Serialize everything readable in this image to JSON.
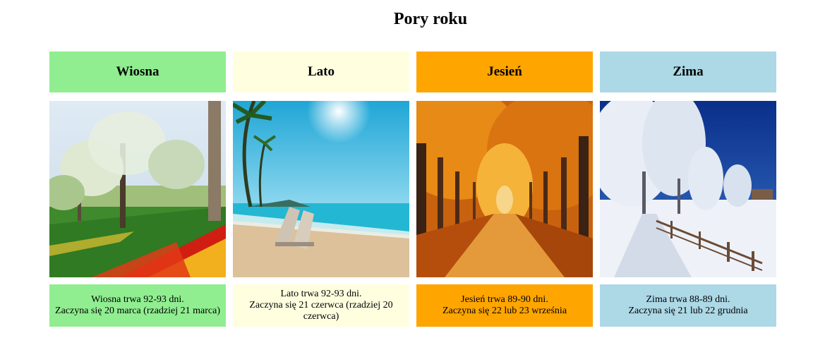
{
  "page": {
    "title": "Pory roku"
  },
  "seasons": [
    {
      "name": "Wiosna",
      "color": "#90EE90",
      "image": "spring-park-tulips",
      "line1": "Wiosna trwa 92-93 dni.",
      "line2": "Zaczyna się 20 marca (rzadziej 21 marca)"
    },
    {
      "name": "Lato",
      "color": "#FFFFE0",
      "image": "summer-beach-loungers",
      "line1": "Lato trwa 92-93 dni.",
      "line2": "Zaczyna się 21 czerwca (rzadziej 20 czerwca)"
    },
    {
      "name": "Jesień",
      "color": "#FFA500",
      "image": "autumn-tree-alley",
      "line1": "Jesień trwa 89-90 dni.",
      "line2": "Zaczyna się 22 lub 23 września"
    },
    {
      "name": "Zima",
      "color": "#ADD8E6",
      "image": "winter-snowy-road",
      "line1": "Zima trwa 88-89 dni.",
      "line2": "Zaczyna się 21 lub 22 grudnia"
    }
  ]
}
